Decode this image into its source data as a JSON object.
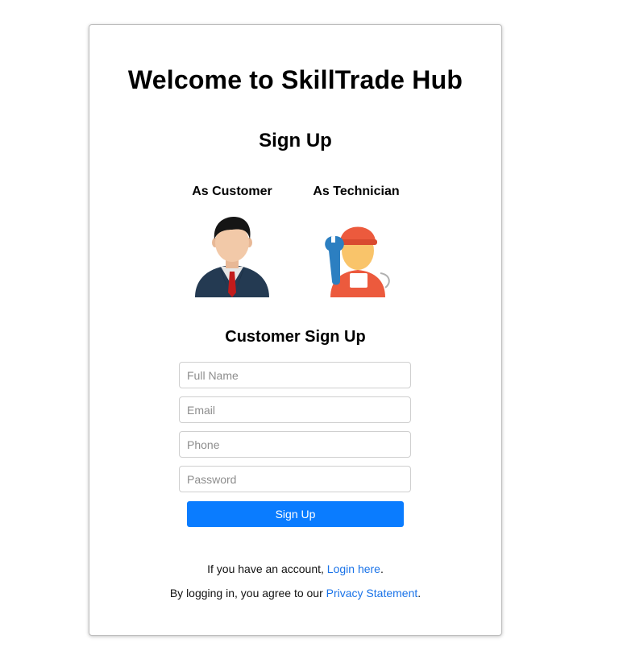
{
  "header": {
    "title": "Welcome to SkillTrade Hub",
    "subtitle": "Sign Up"
  },
  "roles": [
    {
      "label": "As Customer",
      "icon": "customer-avatar-icon"
    },
    {
      "label": "As Technician",
      "icon": "technician-avatar-icon"
    }
  ],
  "form": {
    "title": "Customer Sign Up",
    "fields": [
      {
        "placeholder": "Full Name",
        "value": ""
      },
      {
        "placeholder": "Email",
        "value": ""
      },
      {
        "placeholder": "Phone",
        "value": ""
      },
      {
        "placeholder": "Password",
        "value": ""
      }
    ],
    "submit_label": "Sign Up"
  },
  "footer": {
    "login_prefix": "If you have an account, ",
    "login_link": "Login here",
    "login_suffix": ".",
    "privacy_prefix": "By logging in, you agree to our ",
    "privacy_link": "Privacy Statement",
    "privacy_suffix": "."
  },
  "colors": {
    "accent": "#0a7cff",
    "link": "#1a73e8",
    "card_border": "#bdbdbd"
  }
}
